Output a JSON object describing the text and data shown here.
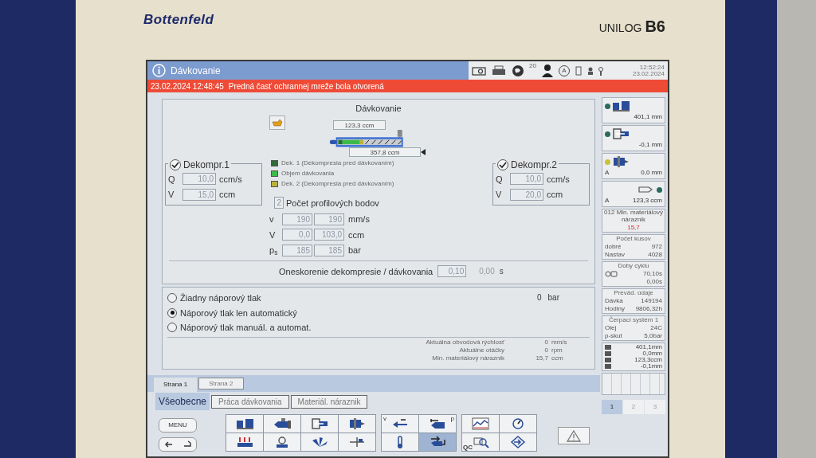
{
  "device": {
    "brand": "Bottenfeld",
    "series": "UNILOG",
    "model": "B6"
  },
  "title_bar": {
    "title": "Dávkovanie",
    "user_count": "20",
    "access_level": "A",
    "time": "12:52:24",
    "date": "23.02.2024"
  },
  "alarm": {
    "timestamp": "23.02.2024 12:48:45",
    "message": "Predná časť ochrannej mreže bola otvorená"
  },
  "dosing_panel": {
    "title": "Dávkovanie",
    "volume_top": "123,3 ccm",
    "volume_bottom": "357,8 ccm",
    "legend": [
      {
        "label": "Dek. 1 (Dekompresia pred dávkovaním)",
        "color": "#2f6b36"
      },
      {
        "label": "Objem dávkovania",
        "color": "#3dba4c"
      },
      {
        "label": "Dek. 2 (Dekompresia pred dávkovaním)",
        "color": "#b9b23c"
      }
    ],
    "decompressions": [
      {
        "label": "Dekompr.1",
        "checked": true,
        "fields": [
          {
            "symbol": "Q",
            "value": "10,0",
            "unit": "ccm/s"
          },
          {
            "symbol": "V",
            "value": "15,0",
            "unit": "ccm"
          }
        ]
      },
      {
        "label": "Dekompr.2",
        "checked": true,
        "fields": [
          {
            "symbol": "Q",
            "value": "10,0",
            "unit": "ccm/s"
          },
          {
            "symbol": "V",
            "value": "20,0",
            "unit": "ccm"
          }
        ]
      }
    ],
    "profile_points": {
      "value": "2",
      "label": "Počet profilových bodov"
    },
    "profile_rows": [
      {
        "symbol": "v",
        "values": [
          "190",
          "190"
        ],
        "unit": "mm/s"
      },
      {
        "symbol": "V",
        "values": [
          "0,0",
          "103,0"
        ],
        "unit": "ccm"
      },
      {
        "symbol": "p$_{s}$",
        "values": [
          "185",
          "185"
        ],
        "unit": "bar"
      }
    ],
    "delay": {
      "label": "Oneskorenie dekompresie / dávkovania",
      "value": "0,10",
      "reading": "0,00",
      "unit": "s"
    }
  },
  "back_pressure": {
    "reading": "0",
    "unit": "bar",
    "options": [
      {
        "label": "Žiadny náporový tlak",
        "selected": false
      },
      {
        "label": "Náporový tlak len automatický",
        "selected": true
      },
      {
        "label": "Náporový tlak manuál. a automat.",
        "selected": false
      }
    ],
    "stats": [
      {
        "label": "Aktuálna obvodová rýchlosť",
        "value": "0",
        "unit": "mm/s"
      },
      {
        "label": "Aktuálne otáčky",
        "value": "0",
        "unit": "rpm"
      },
      {
        "label": "Min. materiálový náraznik",
        "value": "15,7",
        "unit": "ccm"
      }
    ]
  },
  "page_tabs": [
    {
      "label": "Strana 1",
      "selected": true
    },
    {
      "label": "Strana 2",
      "selected": false
    }
  ],
  "section_tabs": [
    {
      "label": "Všeobecne",
      "selected": true
    },
    {
      "label": "Práca dávkovania",
      "selected": false
    },
    {
      "label": "Materiál. náraznik",
      "selected": false
    }
  ],
  "menu_button": "MENU",
  "toolbar_groups": [
    [
      {
        "kind": "mold",
        "selected": false
      },
      {
        "kind": "injection",
        "selected": false
      },
      {
        "kind": "ejector",
        "selected": false
      },
      {
        "kind": "nozzle",
        "selected": false
      },
      {
        "kind": "heaters",
        "selected": false
      },
      {
        "kind": "robot",
        "selected": false
      },
      {
        "kind": "fan",
        "selected": false
      },
      {
        "kind": "core",
        "selected": false
      }
    ],
    [
      {
        "kind": "arrow",
        "corner": "v",
        "selected": false
      },
      {
        "kind": "arrow-bar",
        "corner": "p",
        "selected": false
      },
      {
        "kind": "thermometer",
        "selected": false
      },
      {
        "kind": "swap",
        "selected": true
      }
    ],
    [
      {
        "kind": "chart",
        "selected": false
      },
      {
        "kind": "tool",
        "selected": false
      },
      {
        "kind": "qc",
        "corner": "QC",
        "selected": false
      },
      {
        "kind": "diamond",
        "selected": false
      }
    ]
  ],
  "sidebar": {
    "positions": [
      {
        "kind": "mold",
        "reading": "401,1 mm",
        "color": "#2c6a5e"
      },
      {
        "kind": "ejector",
        "reading": "-0,1 mm",
        "color": "#2c6a5e"
      },
      {
        "kind": "nozzle",
        "prefix": "A",
        "reading": "0,0 mm",
        "color": "#c8c23a"
      },
      {
        "kind": "screw",
        "prefix": "A",
        "reading": "123,3 ccm",
        "color": "#2c6a5e"
      }
    ],
    "cushion": {
      "label": "012 Min. materiálový náraznik",
      "value": "15,7"
    },
    "counters": [
      {
        "title": "Počet kusov",
        "rows": [
          {
            "label": "dobré",
            "value": "972"
          },
          {
            "label": "Nastav",
            "value": "4028"
          }
        ]
      },
      {
        "title": "Doby cyklu",
        "rows": [
          {
            "label": "",
            "value": "70,10s"
          },
          {
            "label": "",
            "value": "0,00s"
          }
        ]
      },
      {
        "title": "Prevád. údaje",
        "rows": [
          {
            "label": "Dávka",
            "value": "149194"
          },
          {
            "label": "Hodiny",
            "value": "9806,32h"
          }
        ]
      },
      {
        "title": "Čerpací systém 1",
        "rows": [
          {
            "label": "Olej",
            "value": "24C"
          },
          {
            "label": "p-skut",
            "value": "5,0bar"
          }
        ]
      }
    ],
    "axes": [
      "401,1mm",
      "0,0mm",
      "123,3ccm",
      "-0,1mm"
    ],
    "pages": [
      {
        "label": "1",
        "selected": true
      },
      {
        "label": "2",
        "selected": false
      },
      {
        "label": "3",
        "selected": false
      }
    ]
  }
}
